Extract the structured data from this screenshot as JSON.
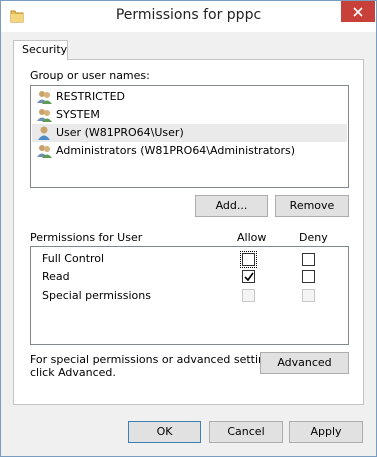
{
  "window": {
    "title": "Permissions for pppc"
  },
  "tabs": [
    {
      "label": "Security"
    }
  ],
  "users": {
    "heading": "Group or user names:",
    "items": [
      {
        "label": "RESTRICTED",
        "icon": "group-icon"
      },
      {
        "label": "SYSTEM",
        "icon": "group-icon"
      },
      {
        "label": "User (W81PRO64\\User)",
        "icon": "user-icon"
      },
      {
        "label": "Administrators (W81PRO64\\Administrators)",
        "icon": "group-icon"
      }
    ],
    "add_label": "Add...",
    "remove_label": "Remove"
  },
  "permissions": {
    "heading": "Permissions for User",
    "allow_header": "Allow",
    "deny_header": "Deny",
    "rows": [
      {
        "label": "Full Control",
        "allow": false,
        "deny": false
      },
      {
        "label": "Read",
        "allow": true,
        "deny": false
      },
      {
        "label": "Special permissions",
        "allow": false,
        "deny": false,
        "disabled": true
      }
    ]
  },
  "advanced": {
    "hint_line1": "For special permissions or advanced settings,",
    "hint_line2": "click Advanced.",
    "button_label": "Advanced"
  },
  "footer": {
    "ok_label": "OK",
    "cancel_label": "Cancel",
    "apply_label": "Apply"
  },
  "colors": {
    "accent": "#3c7fb1",
    "close": "#c7403a",
    "selection": "#eaeaea"
  }
}
